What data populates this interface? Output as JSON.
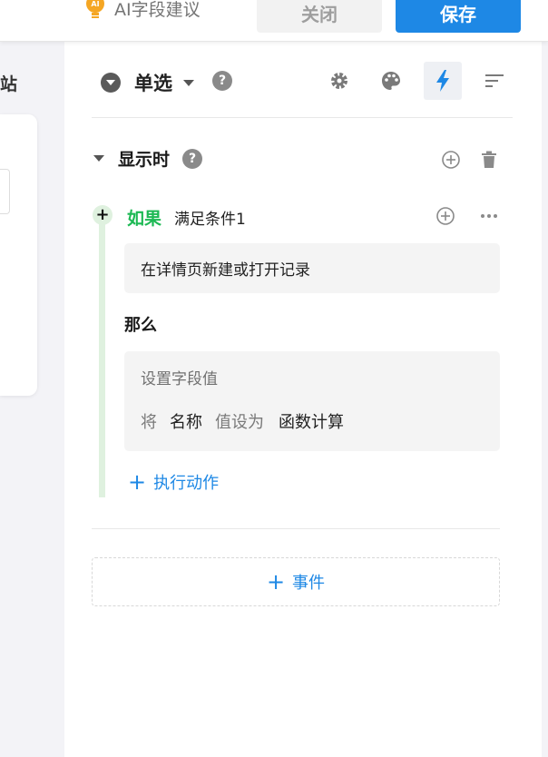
{
  "topbar": {
    "ai_suggest_label": "AI字段建议",
    "ai_badge": "AI",
    "close_label": "关闭",
    "save_label": "保存"
  },
  "left": {
    "partial_label": "站"
  },
  "field": {
    "type_label": "单选",
    "help_mark": "?"
  },
  "toolbar": {
    "icons": [
      "gear-icon",
      "palette-icon",
      "lightning-icon",
      "sort-icon"
    ],
    "active": "lightning-icon"
  },
  "rule": {
    "section_title": "显示时",
    "if_label": "如果",
    "condition_name": "满足条件1",
    "condition_text": "在详情页新建或打开记录",
    "then_label": "那么",
    "action_title": "设置字段值",
    "action_prefix": "将",
    "action_field": "名称",
    "action_verb": "值设为",
    "action_value": "函数计算",
    "exec_action_label": "执行动作",
    "plus_glyph": "+"
  },
  "events": {
    "add_event_label": "事件"
  },
  "colors": {
    "accent": "#1e88e5",
    "if_green": "#1db954",
    "line_green": "#dff1df"
  }
}
